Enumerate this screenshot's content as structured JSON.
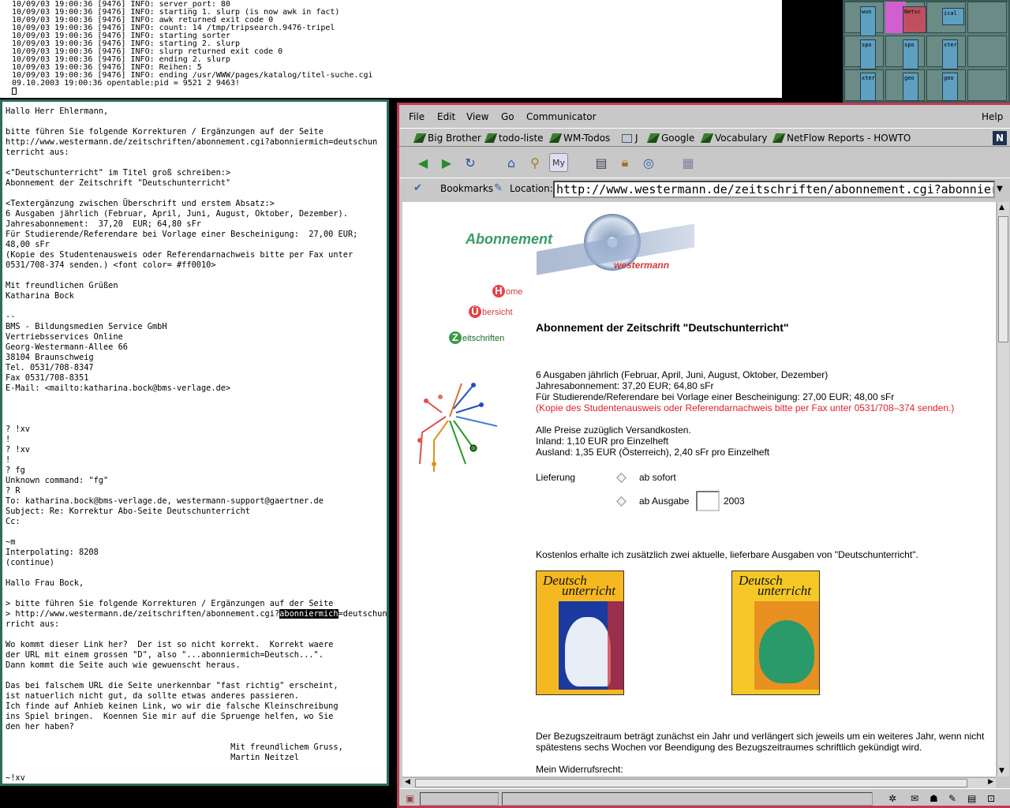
{
  "top_terminal": {
    "lines": [
      "10/09/03 19:00:36 [9476] INFO: server_port: 80",
      "10/09/03 19:00:36 [9476] INFO: starting 1. slurp (is now awk in fact)",
      "10/09/03 19:00:36 [9476] INFO: awk returned exit code 0",
      "10/09/03 19:00:36 [9476] INFO: count: 14 /tmp/tripsearch.9476-tripel",
      "10/09/03 19:00:36 [9476] INFO: starting sorter",
      "10/09/03 19:00:36 [9476] INFO: starting 2. slurp",
      "10/09/03 19:00:36 [9476] INFO: slurp returned exit code 0",
      "10/09/03 19:00:36 [9476] INFO: ending 2. slurp",
      "10/09/03 19:00:36 [9476] INFO: Reihen: 5",
      "10/09/03 19:00:36 [9476] INFO: ending /usr/WWW/pages/katalog/titel-suche.cgi",
      "09.10.2003 19:00:36 opentable:pid = 9521 2 9463!"
    ]
  },
  "pager": {
    "windows": [
      "wun",
      "Netsc",
      "ical",
      "spo",
      "spo",
      "xter",
      "xter",
      "geo",
      "geo"
    ]
  },
  "mail_terminal": {
    "lines_before": [
      "Hallo Herr Ehlermann,",
      "",
      "bitte führen Sie folgende Korrekturen / Ergänzungen auf der Seite",
      "http://www.westermann.de/zeitschriften/abonnement.cgi?abonniermich=deutschun",
      "terricht aus:",
      "",
      "<\"Deutschunterricht\" im Titel groß schreiben:>",
      "Abonnement der Zeitschrift \"Deutschunterricht\"",
      "",
      "<Textergänzung zwischen Überschrift und erstem Absatz:>",
      "6 Ausgaben jährlich (Februar, April, Juni, August, Oktober, Dezember).",
      "Jahresabonnement:  37,20  EUR; 64,80 sFr",
      "Für Studierende/Referendare bei Vorlage einer Bescheinigung:  27,00 EUR;",
      "48,00 sFr",
      "(Kopie des Studentenausweis oder Referendarnachweis bitte per Fax unter",
      "0531/708-374 senden.) <font color= #ff0010>",
      "",
      "Mit freundlichen Grüßen",
      "Katharina Bock",
      "",
      "--",
      "BMS - Bildungsmedien Service GmbH",
      "Vertriebsservices Online",
      "Georg-Westermann-Allee 66",
      "38104 Braunschweig",
      "Tel. 0531/708-8347",
      "Fax 0531/708-8351",
      "E-Mail: <mailto:katharina.bock@bms-verlage.de>",
      "",
      "",
      "",
      "? !xv",
      "!",
      "? !xv",
      "!",
      "? fg",
      "Unknown command: \"fg\"",
      "? R",
      "To: katharina.bock@bms-verlage.de, westermann-support@gaertner.de",
      "Subject: Re: Korrektur Abo-Seite Deutschunterricht",
      "Cc:",
      "",
      "~m",
      "Interpolating: 8208",
      "(continue)",
      "",
      "Hallo Frau Bock,",
      "",
      "> bitte führen Sie folgende Korrekturen / Ergänzungen auf der Seite"
    ],
    "hl_line_pre": "> http://www.westermann.de/zeitschriften/abonnement.cgi?",
    "hl_word": "abonniermich",
    "hl_line_post": "=deutschunte",
    "lines_after": [
      "rricht aus:",
      "",
      "Wo kommt dieser Link her?  Der ist so nicht korrekt.  Korrekt waere",
      "der URL mit einem grossen \"D\", also \"...abonniermich=Deutsch...\".",
      "Dann kommt die Seite auch wie gewuenscht heraus.",
      "",
      "Das bei falschem URL die Seite unerkennbar \"fast richtig\" erscheint,",
      "ist natuerlich nicht gut, da sollte etwas anderes passieren.",
      "Ich finde auf Anhieb keinen Link, wo wir die falsche Kleinschreibung",
      "ins Spiel bringen.  Koennen Sie mir auf die Spruenge helfen, wo Sie",
      "den her haben?",
      "",
      "                                              Mit freundlichem Gruss,",
      "                                              Martin Neitzel",
      "",
      "~!xv"
    ]
  },
  "browser": {
    "menu": [
      "File",
      "Edit",
      "View",
      "Go",
      "Communicator"
    ],
    "menu_help": "Help",
    "personal_toolbar": [
      "Big Brother",
      "todo-liste",
      "WM-Todos",
      "J",
      "Google",
      "Vocabulary",
      "NetFlow Reports - HOWTO"
    ],
    "bookmarks_label": "Bookmarks",
    "location_label": "Location:",
    "url": "http://www.westermann.de/zeitschriften/abonnement.cgi?abonniermich=deutschunterricht",
    "page": {
      "logo_text": "Abonnement",
      "brand": "westermann",
      "nav": [
        {
          "cap": "H",
          "rest": "ome",
          "color": "#e0454a"
        },
        {
          "cap": "Ü",
          "rest": "bersicht",
          "color": "#e0454a"
        },
        {
          "cap": "Z",
          "rest": "eitschriften",
          "color": "#3a9a4a"
        }
      ],
      "heading": "Abonnement der Zeitschrift \"Deutschunterricht\"",
      "para1": [
        "6 Ausgaben jährlich (Februar, April, Juni, August, Oktober, Dezember)",
        "Jahresabonnement:  37,20 EUR; 64,80 sFr",
        "Für Studierende/Referendare bei Vorlage einer Bescheinigung:  27,00 EUR; 48,00 sFr"
      ],
      "para1_red": "(Kopie des Studentenausweis oder Referendarnachweis bitte per Fax unter 0531/708–374 senden.)",
      "para2": [
        "Alle Preise zuzüglich Versandkosten.",
        "Inland: 1,10 EUR pro Einzelheft",
        "Ausland: 1,35 EUR (Österreich), 2,40 sFr pro Einzelheft"
      ],
      "delivery_label": "Lieferung",
      "option1": "ab sofort",
      "option2": "ab Ausgabe",
      "year": "2003",
      "free_issues": "Kostenlos erhalte ich zusätzlich zwei aktuelle, lieferbare Ausgaben von \"Deutschunterricht\".",
      "cover_title_1": "Deutsch",
      "cover_title_2": "unterricht",
      "term_lines": [
        "Der Bezugszeitraum beträgt zunächst ein Jahr und verlängert sich jeweils um ein weiteres Jahr, wenn nicht",
        "spätestens sechs Wochen vor Beendigung des Bezugszeitraumes schriftlich gekündigt wird."
      ],
      "withdrawal": "Mein Widerrufsrecht:"
    }
  }
}
